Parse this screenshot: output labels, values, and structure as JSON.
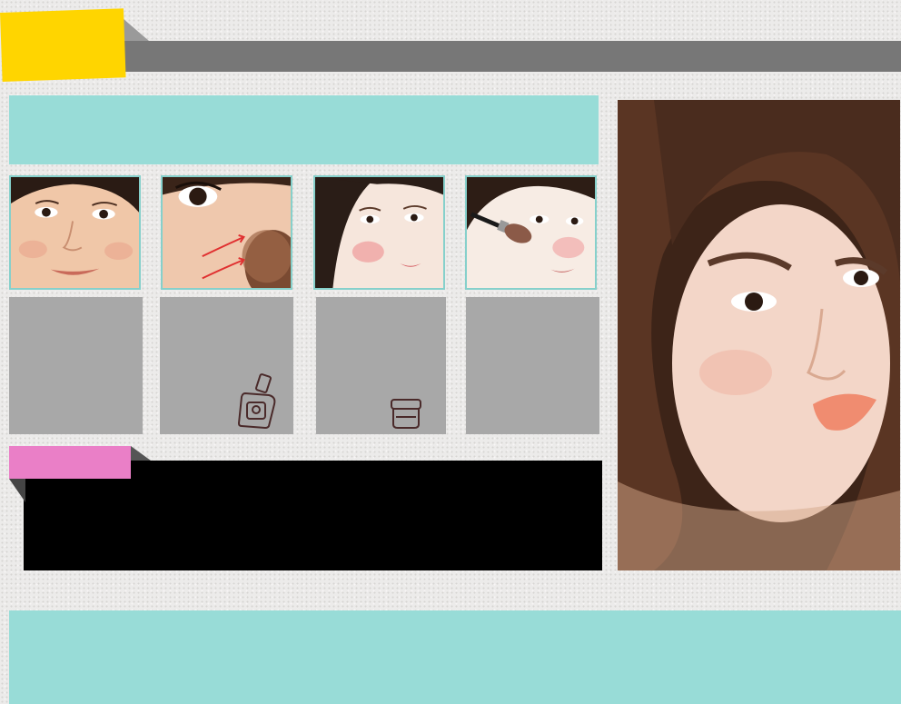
{
  "header": {
    "colors": {
      "yellow_tab": "#ffd500",
      "bar": "#777777"
    }
  },
  "intro_banner": {
    "color": "#98dcd7"
  },
  "steps": [
    {
      "image": "face-closeup-smiling",
      "text_box_color": "#a8a8a8",
      "icon": null
    },
    {
      "image": "cheek-blush-arrows",
      "text_box_color": "#a8a8a8",
      "icon": "nail-polish-bottle-icon"
    },
    {
      "image": "face-with-pink-cheek",
      "text_box_color": "#a8a8a8",
      "icon": "cream-jar-icon"
    },
    {
      "image": "applying-blush-brush",
      "text_box_color": "#a8a8a8",
      "icon": null
    }
  ],
  "tips": {
    "tab_color": "#ea7fc7",
    "box_color": "#000000"
  },
  "portrait": {
    "image": "woman-portrait-coral-lips"
  },
  "bottom_banner": {
    "color": "#98dcd7"
  }
}
